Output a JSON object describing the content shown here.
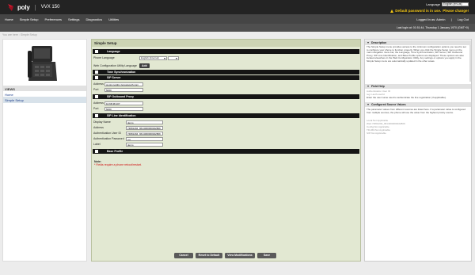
{
  "header": {
    "brand": "poly",
    "model": "VVX 150",
    "language_label": "Language",
    "language_value": "English (en-us)",
    "warning_text": "Default password is in use. Please change!",
    "warning_link": "Please change!",
    "warning_prefix": "Default password is in use."
  },
  "nav": {
    "items": [
      "Home",
      "Simple Setup",
      "Preferences",
      "Settings",
      "Diagnostics",
      "Utilities"
    ]
  },
  "session": {
    "logged_in": "Logged in as: Admin",
    "logout": "Log Out",
    "last_login": "Last login at: 01:51:44, Thursday 1 January 1970 (GMT+0)"
  },
  "breadcrumb": "You are here : Simple Setup",
  "views": {
    "title": "VIEWS",
    "items": [
      "Home",
      "Simple Setup"
    ]
  },
  "main": {
    "title": "Simple Setup",
    "sections": {
      "language": "Language",
      "time_sync": "Time Synchronization",
      "sip_server": "SIP Server",
      "outbound_proxy": "SIP Outbound Proxy",
      "line_id": "SIP Line Identification",
      "base_profile": "Base Profile"
    },
    "phone_language_label": "Phone Language",
    "phone_language_value": "English (Internal)",
    "web_lang_label": "Web Configuration Utility Language",
    "add_button": "Add",
    "sip_server_address_label": "Address",
    "sip_server_address_value": "ca.sip.netpbx.zenuwsouth.com",
    "sip_server_port_label": "Port",
    "sip_server_port_value": "5060",
    "proxy_address_label": "Address",
    "proxy_address_value": "10.68.38.107",
    "proxy_port_label": "Port",
    "proxy_port_value": "5060",
    "display_name_label": "Display Name",
    "display_name_value": "demo",
    "line_address_label": "Address",
    "line_address_value": "74891294_9614000000022809",
    "auth_user_label": "Authentication User ID",
    "auth_user_value": "74891294_9614000000022809",
    "auth_pass_label": "Authentication Password",
    "auth_pass_value": "••••",
    "label_label": "Label",
    "label_value": "demo",
    "note_title": "Note:",
    "note_text": "* Fields require a phone reboot/restart.",
    "buttons": {
      "cancel": "Cancel",
      "reset": "Reset to Default",
      "view_mod": "View Modifications",
      "save": "Save"
    }
  },
  "right": {
    "description_title": "Description",
    "description_text": "The Simple Setup menu provides access to the minimum configuration options you need to set to configure your phone to function properly. When you click the Simple Setup menu on the main navigation menu bar, the Language, Time Synchronization, SIP Server, SIP Outbound Proxy, SIP Line Identification, and Base Profile options are displayed. These options are also located elsewhere in the Web Configuration Utility. Any settings or options you apply in the Simple Setup menu are automatically updated in the other areas.",
    "field_help_title": "Field Help",
    "field_help_name": "Authentication User ID",
    "field_help_key": "reg.1.auth.userId",
    "field_help_text": "Enter the user name used to authenticate the line registration (if applicable).",
    "config_title": "Configured Source Values",
    "config_text": "The parameter values from different sources are listed here. If a parameter value is configured from multiple sources, the phone will use the value from the highest priority source.",
    "config_items": [
      "Local:Not Applicable",
      "Web:74891294_9614000000022809",
      "Config:Not Applicable",
      "TR-069:Not Applicable",
      "SIP:Not Applicable"
    ]
  },
  "colors": {
    "topbar": "#232323",
    "warning": "#f3c614",
    "poly_red": "#d3172e",
    "panel_bg": "#e2e8d2",
    "section_bar": "#151515"
  }
}
